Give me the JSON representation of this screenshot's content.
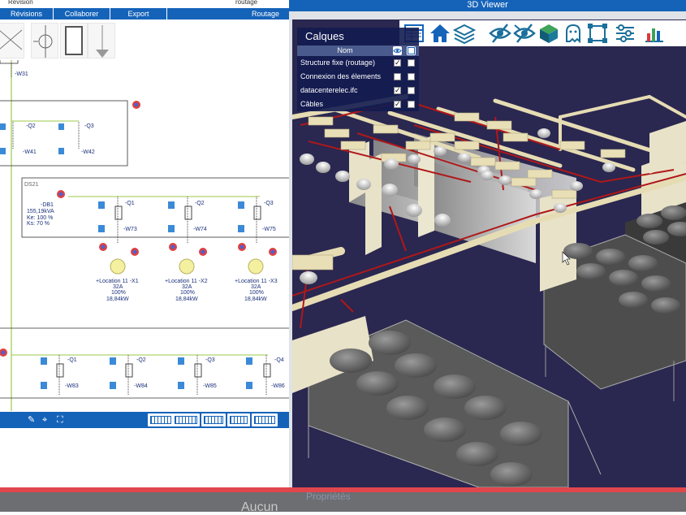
{
  "ribbon": {
    "top_labels": [
      "Révision",
      "routage"
    ],
    "tabs": [
      "Révisions",
      "Collaborer",
      "Export",
      "Routage"
    ]
  },
  "schematic": {
    "feeder": "-W31",
    "breakers_row1": [
      "-Q2",
      "-Q3"
    ],
    "cables_row1": [
      "-W41",
      "-W42"
    ],
    "switchboard": {
      "name": "DS21",
      "breaker": "-DB1",
      "power": "155,19kVA",
      "ke": "Ke: 100 %",
      "ks": "Ks: 70 %"
    },
    "breakers_row2": [
      "-Q1",
      "-Q2",
      "-Q3"
    ],
    "cables_row2": [
      "-W73",
      "-W74",
      "-W75"
    ],
    "outlets": [
      {
        "name": "+Location 11 -X1",
        "current": "32A",
        "percent": "100%",
        "power": "18,84kW"
      },
      {
        "name": "+Location 11 -X2",
        "current": "32A",
        "percent": "100%",
        "power": "18,84kW"
      },
      {
        "name": "+Location 11 -X3",
        "current": "32A",
        "percent": "100%",
        "power": "18,84kW"
      }
    ],
    "breakers_row3": [
      "-Q1",
      "-Q2",
      "-Q3",
      "-Q4"
    ],
    "cables_row3": [
      "-W83",
      "-W84",
      "-W85",
      "-W86"
    ]
  },
  "viewer": {
    "title": "3D Viewer",
    "toolbar_icons": [
      "table-icon",
      "home-icon",
      "layers-icon",
      "hide-icon",
      "hide-all-icon",
      "cube-icon",
      "ghost-icon",
      "fit-icon",
      "settings-icon",
      "chart-icon"
    ],
    "layers_panel": {
      "title": "Calques",
      "column_name": "Nom",
      "rows": [
        {
          "name": "Structure fixe (routage)",
          "visible": true,
          "second": false
        },
        {
          "name": "Connexion des élements",
          "visible": false,
          "second": false
        },
        {
          "name": "datacenterelec.ifc",
          "visible": true,
          "second": false
        },
        {
          "name": "Câbles",
          "visible": true,
          "second": false
        }
      ]
    }
  },
  "bottom": {
    "properties_title": "Propriétés",
    "empty_text": "Aucun"
  },
  "colors": {
    "accent": "#1563b9",
    "scene_background": "#2a2750",
    "highlight_bar": "#e0474c",
    "wire_green": "#9ec94a"
  }
}
